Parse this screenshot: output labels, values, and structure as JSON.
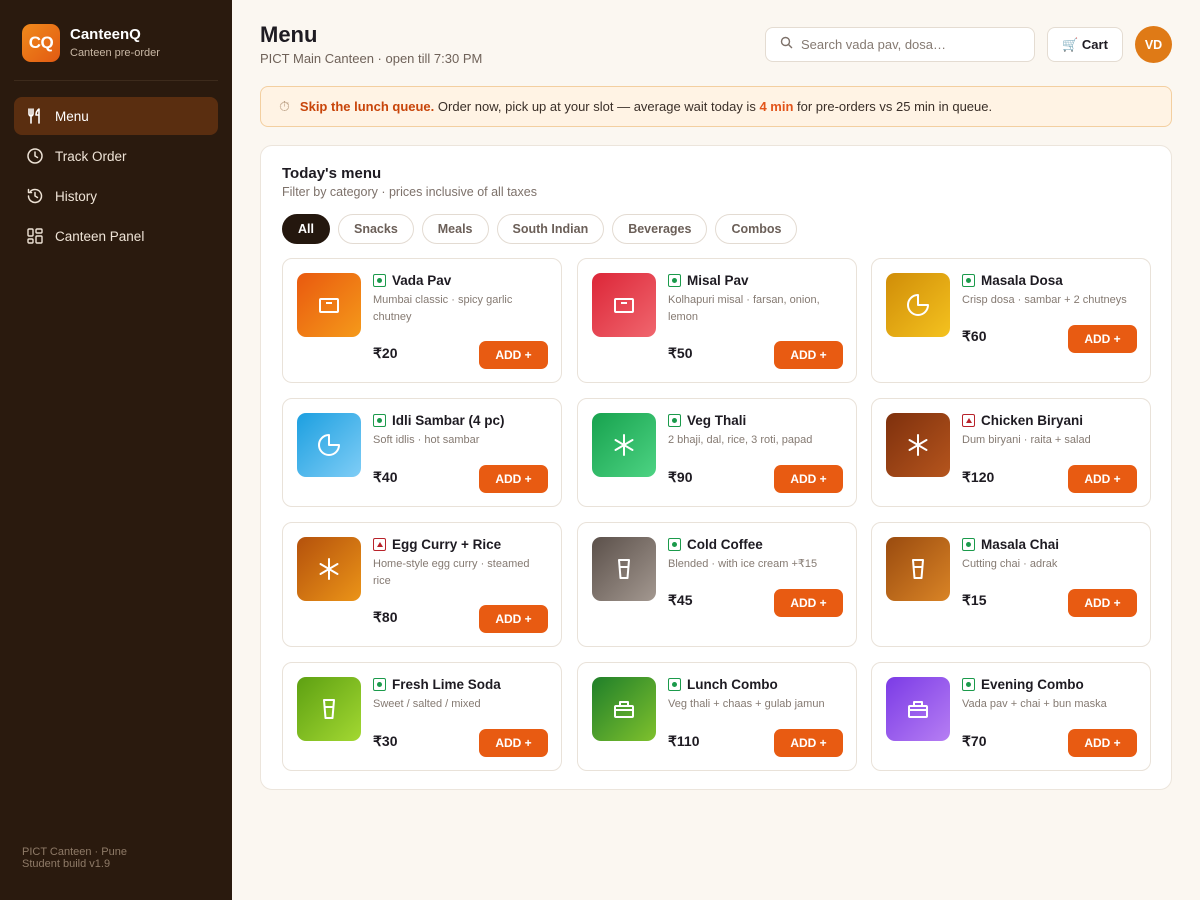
{
  "brand": {
    "logo": "CQ",
    "name": "CanteenQ",
    "subtitle": "Canteen pre-order"
  },
  "sidebar": {
    "items": [
      {
        "label": "Menu",
        "icon": "utensils-icon"
      },
      {
        "label": "Track Order",
        "icon": "clock-icon"
      },
      {
        "label": "History",
        "icon": "history-icon"
      },
      {
        "label": "Canteen Panel",
        "icon": "dashboard-icon"
      }
    ],
    "footer_line1": "PICT Canteen · Pune",
    "footer_line2": "Student build v1.9"
  },
  "header": {
    "title": "Menu",
    "subtitle": "PICT Main Canteen · open till 7:30 PM",
    "search_placeholder": "Search vada pav, dosa…",
    "cart_label": "🛒 Cart",
    "avatar": "VD"
  },
  "banner": {
    "icon": "⏱",
    "strong": "Skip the lunch queue.",
    "text_before": " Order now, pick up at your slot — average wait today is ",
    "wait": "4 min",
    "text_after": " for pre-orders vs 25 min in queue."
  },
  "panel": {
    "title": "Today's menu",
    "subtitle": "Filter by category · prices inclusive of all taxes",
    "chips": [
      "All",
      "Snacks",
      "Meals",
      "South Indian",
      "Beverages",
      "Combos"
    ]
  },
  "add_label": "ADD +",
  "colors": {
    "accent": "#e85b12",
    "sidebar_bg": "#2a1a0e",
    "active_nav": "#5a2e10",
    "veg": "#1b9a4b",
    "nonveg": "#b8222a"
  },
  "items": [
    {
      "name": "Vada Pav",
      "desc": "Mumbai classic · spicy garlic chutney",
      "price": "₹20",
      "veg": true,
      "icon": "box-icon",
      "gradient": [
        "#e9590f",
        "#f59a1a"
      ]
    },
    {
      "name": "Misal Pav",
      "desc": "Kolhapuri misal · farsan, onion, lemon",
      "price": "₹50",
      "veg": true,
      "icon": "box-icon",
      "gradient": [
        "#dc2638",
        "#f0666e"
      ]
    },
    {
      "name": "Masala Dosa",
      "desc": "Crisp dosa · sambar + 2 chutneys",
      "price": "₹60",
      "veg": true,
      "icon": "pie-icon",
      "gradient": [
        "#d08d08",
        "#f4c21f"
      ]
    },
    {
      "name": "Idli Sambar (4 pc)",
      "desc": "Soft idlis · hot sambar",
      "price": "₹40",
      "veg": true,
      "icon": "pie-icon",
      "gradient": [
        "#1c9fe0",
        "#7fcdf6"
      ]
    },
    {
      "name": "Veg Thali",
      "desc": "2 bhaji, dal, rice, 3 roti, papad",
      "price": "₹90",
      "veg": true,
      "icon": "asterisk-icon",
      "gradient": [
        "#17a24e",
        "#4dd383"
      ]
    },
    {
      "name": "Chicken Biryani",
      "desc": "Dum biryani · raita + salad",
      "price": "₹120",
      "veg": false,
      "icon": "asterisk-icon",
      "gradient": [
        "#7e300d",
        "#b5551d"
      ]
    },
    {
      "name": "Egg Curry + Rice",
      "desc": "Home-style egg curry · steamed rice",
      "price": "₹80",
      "veg": false,
      "icon": "asterisk-icon",
      "gradient": [
        "#b4510c",
        "#eb9418"
      ]
    },
    {
      "name": "Cold Coffee",
      "desc": "Blended · with ice cream +₹15",
      "price": "₹45",
      "veg": true,
      "icon": "cup-icon",
      "gradient": [
        "#5b504a",
        "#a39890"
      ]
    },
    {
      "name": "Masala Chai",
      "desc": "Cutting chai · adrak",
      "price": "₹15",
      "veg": true,
      "icon": "cup-icon",
      "gradient": [
        "#9a4b0f",
        "#d98426"
      ]
    },
    {
      "name": "Fresh Lime Soda",
      "desc": "Sweet / salted / mixed",
      "price": "₹30",
      "veg": true,
      "icon": "cup-icon",
      "gradient": [
        "#5da012",
        "#a3d832"
      ]
    },
    {
      "name": "Lunch Combo",
      "desc": "Veg thali + chaas + gulab jamun",
      "price": "₹110",
      "veg": true,
      "icon": "bag-icon",
      "gradient": [
        "#1f7f2a",
        "#7fc12d"
      ]
    },
    {
      "name": "Evening Combo",
      "desc": "Vada pav + chai + bun maska",
      "price": "₹70",
      "veg": true,
      "icon": "bag-icon",
      "gradient": [
        "#7b3be6",
        "#b67ef3"
      ]
    }
  ]
}
